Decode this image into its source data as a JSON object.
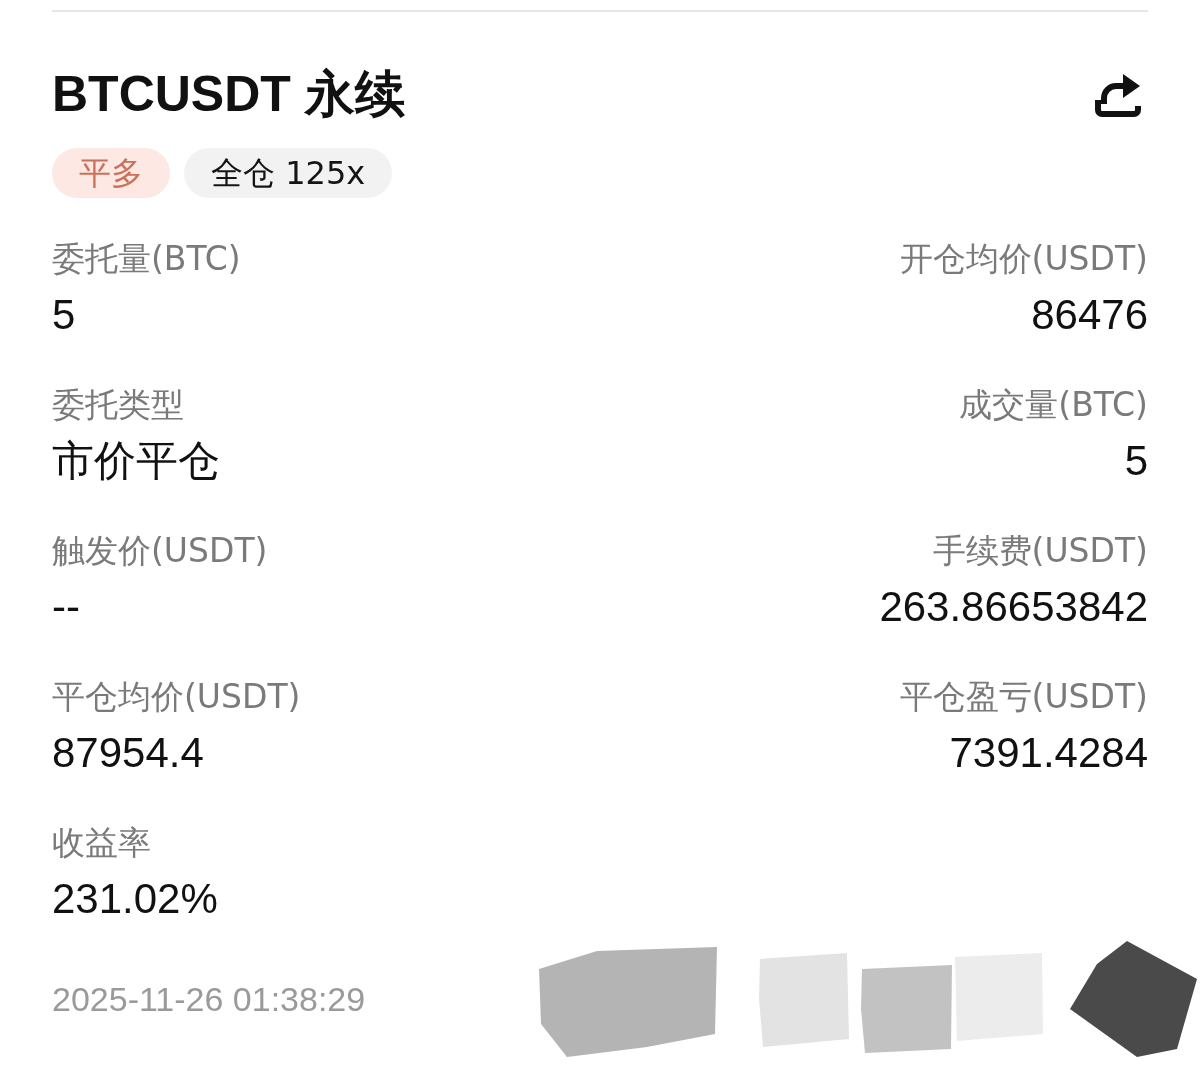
{
  "header": {
    "title": "BTCUSDT 永续"
  },
  "tags": [
    {
      "label": "平多",
      "kind": "side"
    },
    {
      "label": "全仓 125x",
      "kind": "margin"
    }
  ],
  "fields": [
    {
      "label": "委托量(BTC)",
      "value": "5"
    },
    {
      "label": "开仓均价(USDT)",
      "value": "86476"
    },
    {
      "label": "委托类型",
      "value": "市价平仓"
    },
    {
      "label": "成交量(BTC)",
      "value": "5"
    },
    {
      "label": "触发价(USDT)",
      "value": "--"
    },
    {
      "label": "手续费(USDT)",
      "value": "263.86653842"
    },
    {
      "label": "平仓均价(USDT)",
      "value": "87954.4"
    },
    {
      "label": "平仓盈亏(USDT)",
      "value": "7391.4284"
    },
    {
      "label": "收益率",
      "value": "231.02%"
    }
  ],
  "footer": {
    "timestamp": "2025-11-26 01:38:29"
  }
}
